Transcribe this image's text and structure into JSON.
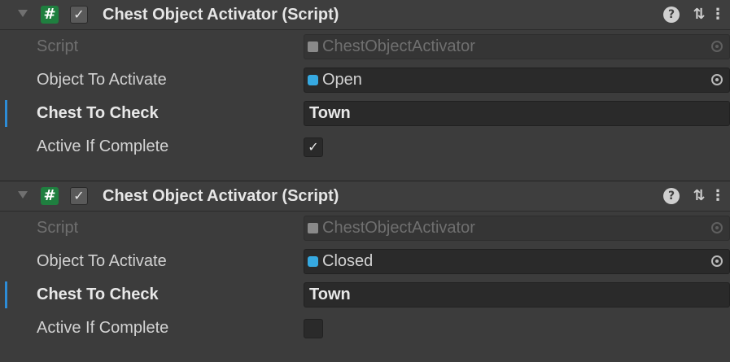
{
  "components": [
    {
      "title": "Chest Object Activator (Script)",
      "enabled_check": "✓",
      "fields": {
        "script": {
          "label": "Script",
          "value": "ChestObjectActivator"
        },
        "object": {
          "label": "Object To Activate",
          "value": "Open"
        },
        "chest": {
          "label": "Chest To Check",
          "value": "Town"
        },
        "active": {
          "label": "Active If Complete",
          "checked": true,
          "mark": "✓"
        }
      }
    },
    {
      "title": "Chest Object Activator (Script)",
      "enabled_check": "✓",
      "fields": {
        "script": {
          "label": "Script",
          "value": "ChestObjectActivator"
        },
        "object": {
          "label": "Object To Activate",
          "value": "Closed"
        },
        "chest": {
          "label": "Chest To Check",
          "value": "Town"
        },
        "active": {
          "label": "Active If Complete",
          "checked": false,
          "mark": ""
        }
      }
    }
  ],
  "icons": {
    "foldout": "foldout-triangle-icon",
    "script": "script-hash-icon",
    "help": "help-icon",
    "preset": "preset-sliders-icon",
    "more": "kebab-menu-icon",
    "script_file": "script-file-icon",
    "gameobject": "gameobject-cube-icon",
    "object_picker": "object-picker-target-icon"
  },
  "colors": {
    "background": "#3c3c3c",
    "field": "#2a2a2a",
    "script_icon": "#1f7f3f",
    "override_marker": "#2d8cd6",
    "gameobject_icon": "#36a9e1"
  }
}
